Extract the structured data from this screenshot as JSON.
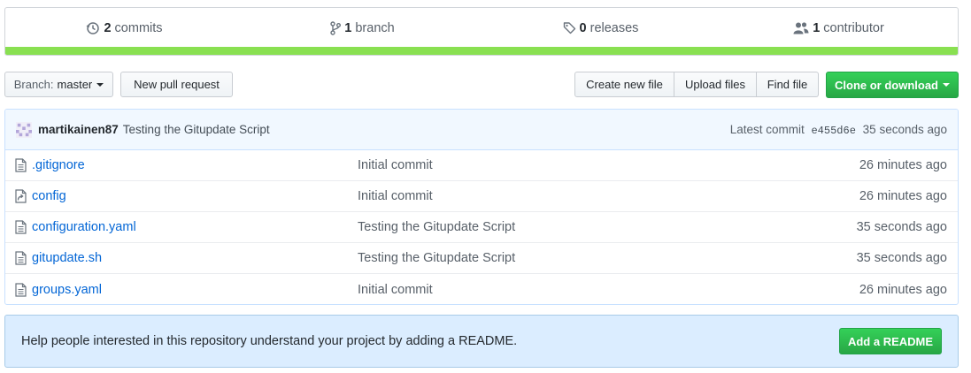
{
  "summary": {
    "commits": {
      "count": "2",
      "label": "commits",
      "icon": "history-icon"
    },
    "branches": {
      "count": "1",
      "label": "branch",
      "icon": "git-branch-icon"
    },
    "releases": {
      "count": "0",
      "label": "releases",
      "icon": "tag-icon"
    },
    "contributors": {
      "count": "1",
      "label": "contributor",
      "icon": "people-icon"
    },
    "language_color": "#89e051"
  },
  "toolbar": {
    "branch_prefix": "Branch:",
    "branch_name": "master",
    "new_pull_request": "New pull request",
    "create_new_file": "Create new file",
    "upload_files": "Upload files",
    "find_file": "Find file",
    "clone_or_download": "Clone or download"
  },
  "commit": {
    "author": "martikainen87",
    "message": "Testing the Gitupdate Script",
    "latest_label": "Latest commit",
    "sha": "e455d6e",
    "age": "35 seconds ago"
  },
  "files": [
    {
      "name": ".gitignore",
      "icon": "file-icon",
      "message": "Initial commit",
      "age": "26 minutes ago"
    },
    {
      "name": "config",
      "icon": "symlink-file-icon",
      "message": "Initial commit",
      "age": "26 minutes ago"
    },
    {
      "name": "configuration.yaml",
      "icon": "file-icon",
      "message": "Testing the Gitupdate Script",
      "age": "35 seconds ago"
    },
    {
      "name": "gitupdate.sh",
      "icon": "file-icon",
      "message": "Testing the Gitupdate Script",
      "age": "35 seconds ago"
    },
    {
      "name": "groups.yaml",
      "icon": "file-icon",
      "message": "Initial commit",
      "age": "26 minutes ago"
    }
  ],
  "readme": {
    "text": "Help people interested in this repository understand your project by adding a README.",
    "button": "Add a README"
  },
  "colors": {
    "link": "#0366d6",
    "primary_button": "#28a745",
    "commit_bar_bg": "#f1f8ff",
    "readme_bg": "#dbedff"
  }
}
